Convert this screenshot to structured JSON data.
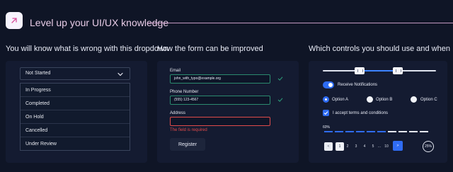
{
  "header": {
    "title": "Level up your UI/UX knowledge",
    "icon": "arrow-up-right-icon"
  },
  "columns": {
    "dropdown_title": "You will know what is wrong with this dropdown",
    "form_title": "How the form can be improved",
    "controls_title": "Which controls you should use and when"
  },
  "dropdown": {
    "selected": "Not Started",
    "options": [
      "In Progress",
      "Completed",
      "On Hold",
      "Cancelled",
      "Under Review"
    ]
  },
  "form": {
    "email_label": "Email",
    "email_value": "john_with_typo@example.org",
    "phone_label": "Phone Number",
    "phone_value": "(555) 123-4567",
    "address_label": "Address",
    "address_value": "",
    "error_text": "The field is required",
    "submit_label": "Register"
  },
  "controls": {
    "toggle_label": "Receive Notifications",
    "radio_options": [
      "Option A",
      "Option B",
      "Option C"
    ],
    "checkbox_label": "I accept terms and conditions",
    "progress_label": "60%",
    "progress_value": 60,
    "pagination": {
      "prev": "<",
      "pages": [
        "1",
        "2",
        "3",
        "4",
        "5",
        "...",
        "10"
      ],
      "next": ">"
    },
    "circular_progress_label": "25%",
    "circular_progress_value": 25
  },
  "colors": {
    "background": "#0f1526",
    "panel": "#141b31",
    "accent": "#2f6cf3",
    "header_pink": "#e7cbe6",
    "success": "#2b8a6f",
    "error": "#e24a4a"
  }
}
